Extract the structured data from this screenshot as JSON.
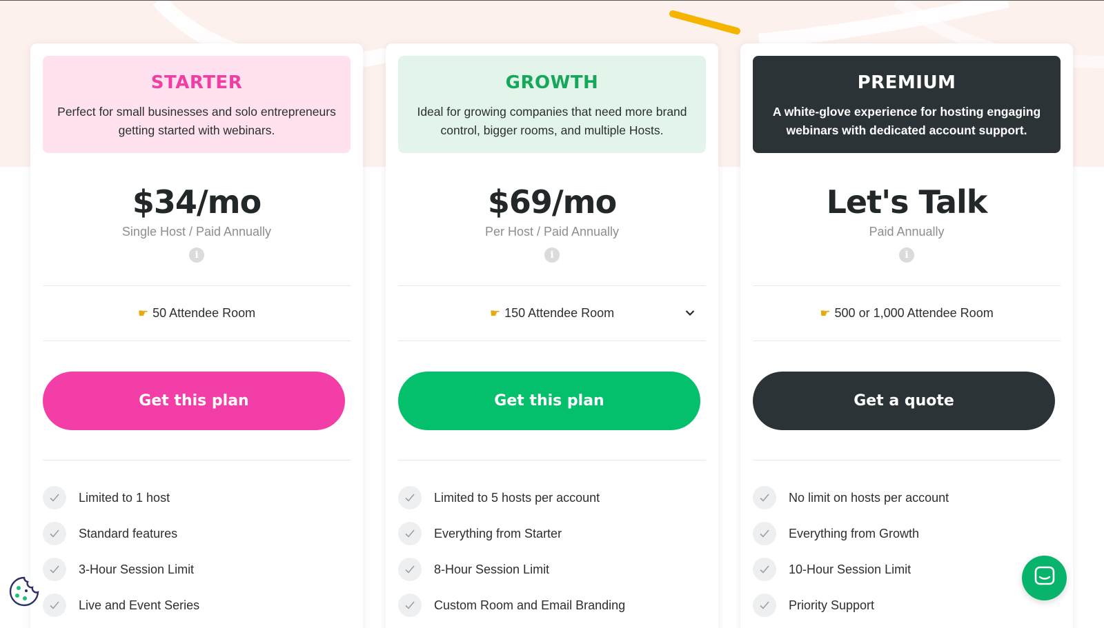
{
  "plans": [
    {
      "name": "STARTER",
      "description": "Perfect for small businesses and solo entrepreneurs getting started with webinars.",
      "price": "$34/mo",
      "billing": "Single Host / Paid Annually",
      "room": "50 Attendee Room",
      "cta": "Get this plan",
      "features": [
        "Limited to 1 host",
        "Standard features",
        "3-Hour Session Limit",
        "Live and Event Series"
      ]
    },
    {
      "name": "GROWTH",
      "description": "Ideal for growing companies that need more brand control, bigger rooms, and multiple Hosts.",
      "price": "$69/mo",
      "billing": "Per Host / Paid Annually",
      "room": "150 Attendee Room",
      "cta": "Get this plan",
      "features": [
        "Limited to 5 hosts per account",
        "Everything from Starter",
        "8-Hour Session Limit",
        "Custom Room and Email Branding"
      ]
    },
    {
      "name": "PREMIUM",
      "description": "A white-glove experience for hosting engaging webinars with dedicated account support.",
      "price": "Let's Talk",
      "billing": "Paid Annually",
      "room": "500 or 1,000 Attendee Room",
      "cta": "Get a quote",
      "features": [
        "No limit on hosts per account",
        "Everything from Growth",
        "10-Hour Session Limit",
        "Priority Support"
      ]
    }
  ],
  "icons": {
    "room_pointer": "pointing-hand-icon",
    "info": "info-icon",
    "check": "check-icon",
    "dropdown": "chevron-down-icon",
    "cookie": "cookie-icon",
    "chat": "chat-icon"
  },
  "colors": {
    "starter_accent": "#f23ea6",
    "growth_accent": "#04bf6b",
    "premium_accent": "#2b3336",
    "chat": "#08b36b"
  }
}
